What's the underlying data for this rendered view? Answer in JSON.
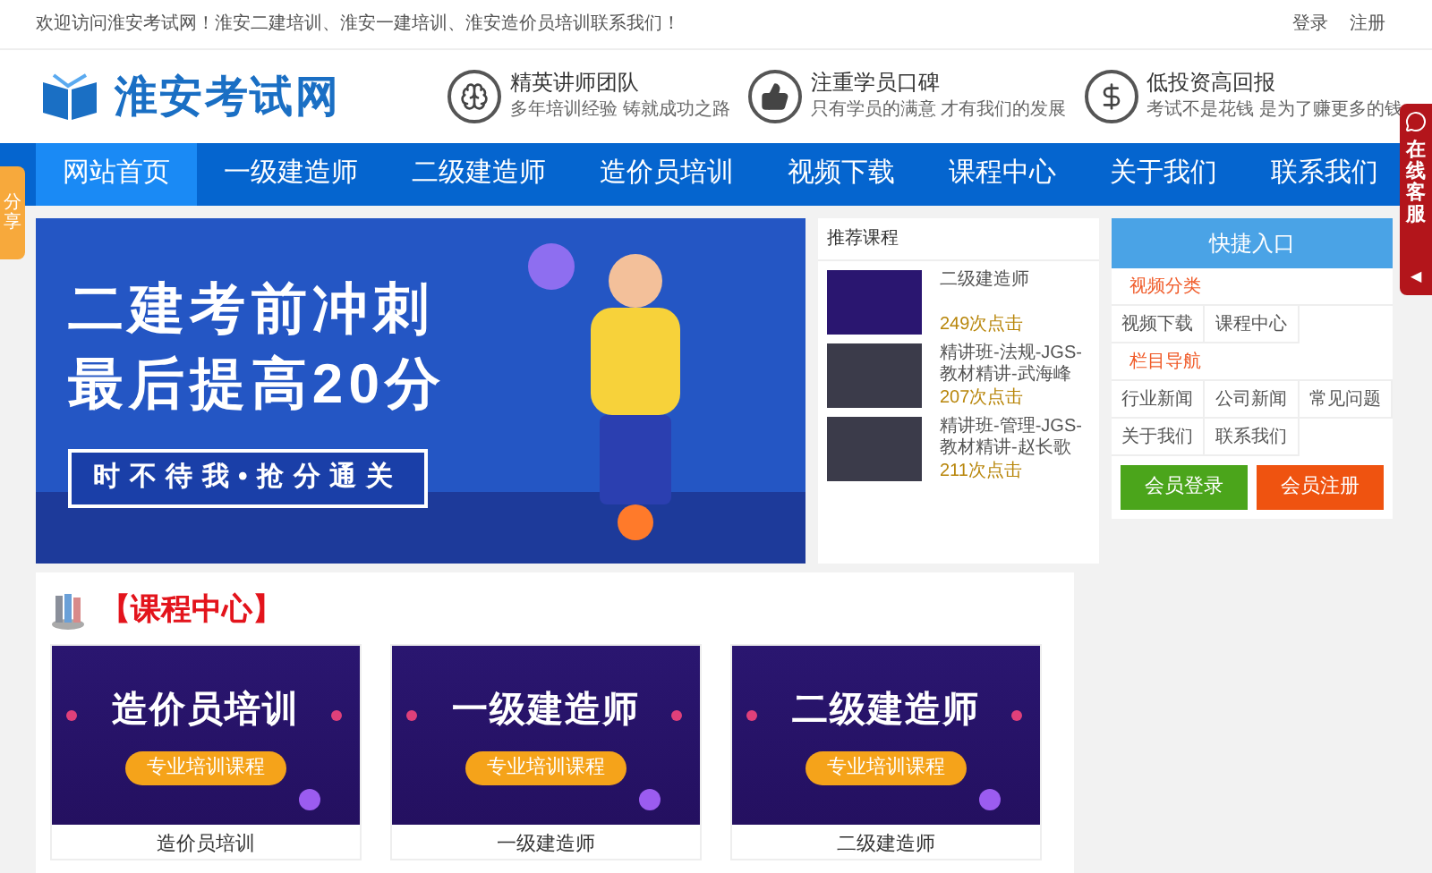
{
  "top_bar": {
    "welcome": "欢迎访问淮安考试网！淮安二建培训、淮安一建培训、淮安造价员培训联系我们！",
    "links": [
      "登录",
      "注册"
    ]
  },
  "header": {
    "logo_text": "淮安考试网",
    "features": [
      {
        "kind": "team",
        "title": "精英讲师团队",
        "subtitle": "多年培训经验 铸就成功之路"
      },
      {
        "kind": "praise",
        "title": "注重学员口碑",
        "subtitle": "只有学员的满意 才有我们的发展"
      },
      {
        "kind": "money",
        "title": "低投资高回报",
        "subtitle": "考试不是花钱 是为了赚更多的钱"
      }
    ]
  },
  "nav": {
    "items": [
      {
        "label": "网站首页",
        "selected": true
      },
      {
        "label": "一级建造师",
        "selected": false
      },
      {
        "label": "二级建造师",
        "selected": false
      },
      {
        "label": "造价员培训",
        "selected": false
      },
      {
        "label": "视频下载",
        "selected": false
      },
      {
        "label": "课程中心",
        "selected": false
      },
      {
        "label": "关于我们",
        "selected": false
      },
      {
        "label": "联系我们",
        "selected": false
      }
    ]
  },
  "share_tab": "分享",
  "service_tab": "在线客服",
  "service_collapse": "◀",
  "banner": {
    "headline": [
      "二建考前冲刺",
      "最后提高20分"
    ],
    "slogan": "时不待我•抢分通关"
  },
  "recommended": {
    "title": "推荐课程",
    "courses": [
      {
        "kind": "poster",
        "title": "二级建造师",
        "clicks": "249次点击"
      },
      {
        "kind": "photo",
        "title": "精讲班-法规-JGS-教材精讲-武海峰",
        "clicks": "207次点击"
      },
      {
        "kind": "photo",
        "title": "精讲班-管理-JGS-教材精讲-赵长歌",
        "clicks": "211次点击"
      }
    ]
  },
  "quick": {
    "title": "快捷入口",
    "sections": [
      {
        "heading": "视频分类",
        "links": [
          "视频下载",
          "课程中心"
        ]
      },
      {
        "heading": "栏目导航",
        "links": [
          "行业新闻",
          "公司新闻",
          "常见问题",
          "关于我们",
          "联系我们"
        ]
      }
    ],
    "buttons": [
      {
        "kind": "login",
        "label": "会员登录"
      },
      {
        "kind": "register",
        "label": "会员注册"
      }
    ]
  },
  "course_center": {
    "title": "【课程中心】",
    "courses": [
      {
        "poster_title": "造价员培训",
        "poster_tag": "专业培训课程",
        "caption": "造价员培训"
      },
      {
        "poster_title": "一级建造师",
        "poster_tag": "专业培训课程",
        "caption": "一级建造师"
      },
      {
        "poster_title": "二级建造师",
        "poster_tag": "专业培训课程",
        "caption": "二级建造师"
      }
    ]
  }
}
